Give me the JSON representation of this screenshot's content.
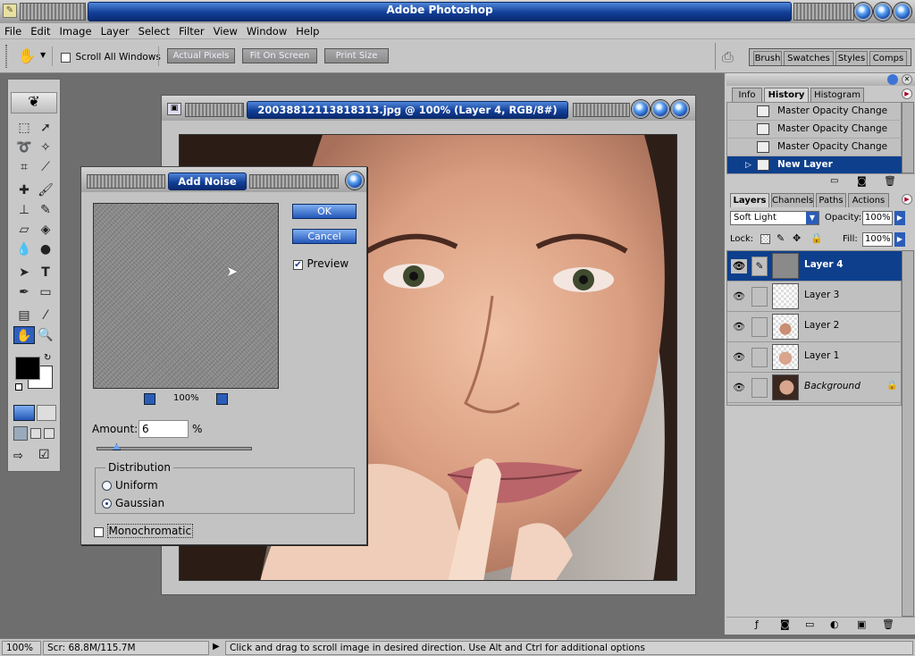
{
  "app": {
    "title": "Adobe Photoshop",
    "icon": "photoshop-feather-icon"
  },
  "menu": {
    "items": [
      "File",
      "Edit",
      "Image",
      "Layer",
      "Select",
      "Filter",
      "View",
      "Window",
      "Help"
    ]
  },
  "options_bar": {
    "tool_icon": "hand-icon",
    "scroll_all_windows_label": "Scroll All Windows",
    "scroll_all_windows_checked": false,
    "buttons": [
      "Actual Pixels",
      "Fit On Screen",
      "Print Size"
    ],
    "palette_well_tabs": [
      "Brush",
      "Swatches",
      "Styles",
      "Comps"
    ]
  },
  "document": {
    "title": "20038812113818313.jpg @ 100% (Layer 4, RGB/8#)"
  },
  "add_noise": {
    "title": "Add Noise",
    "ok_label": "OK",
    "cancel_label": "Cancel",
    "preview_label": "Preview",
    "preview_checked": true,
    "zoom_label": "100%",
    "amount_label": "Amount:",
    "amount_value": "6",
    "amount_unit": "%",
    "amount_slider_fraction": 0.06,
    "distribution_label": "Distribution",
    "uniform_label": "Uniform",
    "gaussian_label": "Gaussian",
    "selected_distribution": "Gaussian",
    "monochromatic_label": "Monochromatic",
    "monochromatic_checked": false
  },
  "history_panel": {
    "tabs": [
      "Info",
      "History",
      "Histogram"
    ],
    "active_tab": "History",
    "items": [
      {
        "label": "Master Opacity Change"
      },
      {
        "label": "Master Opacity Change"
      },
      {
        "label": "Master Opacity Change"
      },
      {
        "label": "New Layer",
        "selected": true
      }
    ]
  },
  "layers_panel": {
    "tabs": [
      "Layers",
      "Channels",
      "Paths",
      "Actions"
    ],
    "active_tab": "Layers",
    "blend_mode": "Soft Light",
    "opacity_label": "Opacity:",
    "opacity_value": "100%",
    "lock_label": "Lock:",
    "fill_label": "Fill:",
    "fill_value": "100%",
    "layers": [
      {
        "name": "Layer 4",
        "selected": true
      },
      {
        "name": "Layer 3"
      },
      {
        "name": "Layer 2"
      },
      {
        "name": "Layer 1"
      },
      {
        "name": "Background",
        "locked": true
      }
    ]
  },
  "status": {
    "zoom": "100%",
    "scratch": "Scr: 68.8M/115.7M",
    "hint": "Click and drag to scroll image in desired direction.  Use Alt and Ctrl for additional options"
  },
  "colors": {
    "title_blue": "#123f98",
    "selection_blue": "#0e3f8c",
    "panel_gray": "#c8c8c8",
    "workspace_gray": "#6e6e6e"
  }
}
